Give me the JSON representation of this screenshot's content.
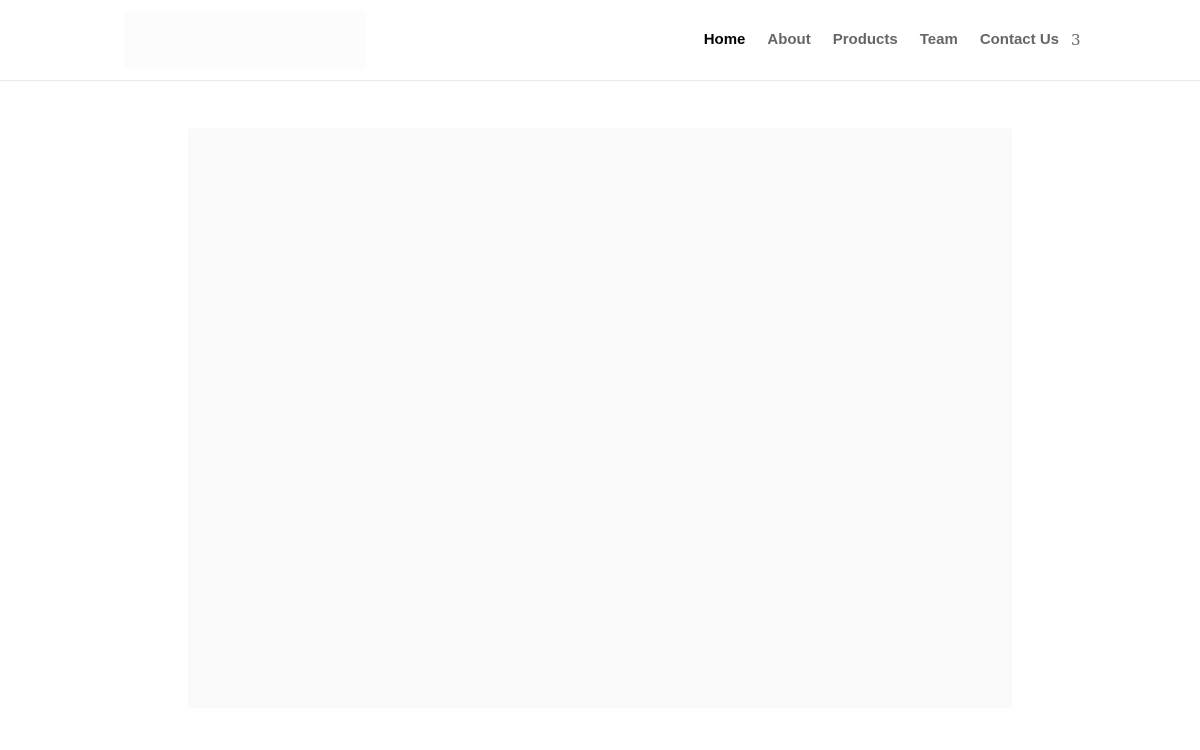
{
  "header": {
    "nav": {
      "items": [
        {
          "label": "Home",
          "active": true
        },
        {
          "label": "About",
          "active": false
        },
        {
          "label": "Products",
          "active": false
        },
        {
          "label": "Team",
          "active": false
        },
        {
          "label": "Contact Us",
          "active": false
        }
      ],
      "dropdown_icon": "chevron-down-icon"
    }
  },
  "colors": {
    "nav_active": "#000000",
    "nav_inactive": "#666666",
    "hero_bg": "#fafafa",
    "logo_bg": "#fcfcfc"
  }
}
